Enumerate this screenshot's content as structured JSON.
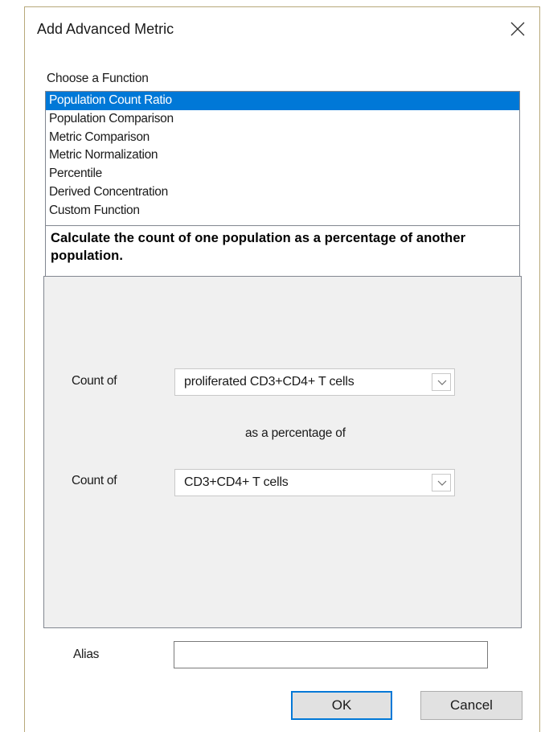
{
  "dialog": {
    "title": "Add Advanced Metric",
    "close_icon": "close-icon"
  },
  "function_chooser": {
    "label": "Choose a Function",
    "items": [
      "Population Count Ratio",
      "Population Comparison",
      "Metric Comparison",
      "Metric Normalization",
      "Percentile",
      "Derived Concentration",
      "Custom Function"
    ],
    "selected_index": 0,
    "description": "Calculate the count of one population as a percentage of another population."
  },
  "parameters": {
    "numerator_label": "Count of",
    "numerator_value": "proliferated CD3+CD4+ T cells",
    "connector_text": "as a percentage of",
    "denominator_label": "Count of",
    "denominator_value": "CD3+CD4+ T cells",
    "dropdown_icon": "chevron-down-icon"
  },
  "alias": {
    "label": "Alias",
    "value": ""
  },
  "buttons": {
    "ok": "OK",
    "cancel": "Cancel"
  },
  "colors": {
    "selection": "#0078d7",
    "panel_background": "#f0f0f0",
    "default_button_border": "#0078d7"
  }
}
